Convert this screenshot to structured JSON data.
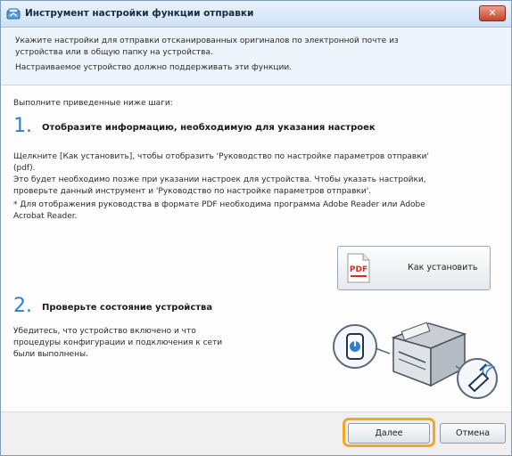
{
  "window": {
    "title": "Инструмент настройки функции отправки",
    "close_label": "✕"
  },
  "intro": {
    "lines": [
      "Укажите настройки для отправки отсканированных оригиналов по электронной почте из",
      "устройства или в общую папку на устройства.",
      "Настраиваемое устройство должно поддерживать эти функции."
    ]
  },
  "steps_lead": "Выполните приведенные ниже шаги:",
  "step1": {
    "number": "1.",
    "title": "Отобразите информацию, необходимую для указания настроек",
    "lines": [
      "Щелкните [Как установить], чтобы отобразить 'Руководство по настройке параметров отправки'",
      "(pdf).",
      "Это будет необходимо позже при указании настроек для устройства. Чтобы указать настройки,",
      "проверьте данный инструмент и 'Руководство по настройке параметров отправки'.",
      "* Для отображения руководства в формате PDF необходима программа Adobe Reader или Adobe",
      "Acrobat Reader."
    ],
    "button_label": "Как установить",
    "pdf_text": "PDF"
  },
  "step2": {
    "number": "2.",
    "title": "Проверьте состояние устройства",
    "lines": [
      "Убедитесь, что устройство включено и что",
      "процедуры конфигурации и подключения к сети",
      "были выполнены."
    ]
  },
  "footer": {
    "next_label": "Далее",
    "cancel_label": "Отмена"
  },
  "colors": {
    "accent": "#2e7fd0",
    "highlight": "#f5a623",
    "pdf_red": "#d62b1f"
  }
}
